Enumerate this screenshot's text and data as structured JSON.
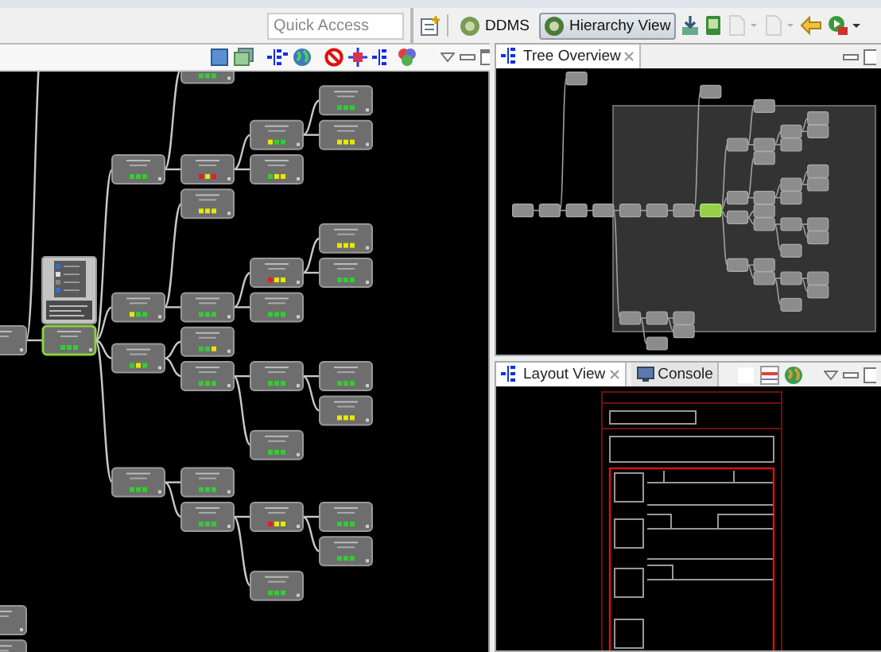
{
  "toolbar": {
    "quick_access": {
      "placeholder": "Quick Access"
    },
    "perspectives": [
      {
        "label": "DDMS",
        "selected": false
      },
      {
        "label": "Hierarchy View",
        "selected": true
      }
    ]
  },
  "tree": {
    "selected": false,
    "children": [
      {
        "selected": false,
        "children": [
          {
            "selected": false
          },
          {
            "selected": false,
            "children": [
              {
                "selected": false,
                "children": [
                  {
                    "selected": false,
                    "children": [
                      {
                        "selected": false,
                        "children": [
                          {
                            "selected": false,
                            "children": [
                              {
                                "selected": false
                              },
                              {
                                "selected": true,
                                "dots": [
                                  {
                                    "color": "#33cc33"
                                  },
                                  {
                                    "color": "#33cc33"
                                  },
                                  {
                                    "color": "#33cc33"
                                  }
                                ],
                                "children": [
                                  {
                                    "selected": false,
                                    "dots": [
                                      {
                                        "color": "#33cc33"
                                      },
                                      {
                                        "color": "#33cc33"
                                      },
                                      {
                                        "color": "#33cc33"
                                      }
                                    ],
                                    "children": [
                                      {
                                        "selected": false,
                                        "dots": [
                                          {
                                            "color": "#33cc33"
                                          },
                                          {
                                            "color": "#33cc33"
                                          },
                                          {
                                            "color": "#33cc33"
                                          }
                                        ]
                                      },
                                      {
                                        "selected": false,
                                        "dots": [
                                          {
                                            "color": "#e02020"
                                          },
                                          {
                                            "color": "#e8e800"
                                          },
                                          {
                                            "color": "#e02020"
                                          }
                                        ],
                                        "children": [
                                          {
                                            "selected": false,
                                            "dots": [
                                              {
                                                "color": "#e8e800"
                                              },
                                              {
                                                "color": "#33cc33"
                                              },
                                              {
                                                "color": "#33cc33"
                                              }
                                            ],
                                            "children": [
                                              {
                                                "selected": false,
                                                "dots": [
                                                  {
                                                    "color": "#33cc33"
                                                  },
                                                  {
                                                    "color": "#33cc33"
                                                  },
                                                  {
                                                    "color": "#33cc33"
                                                  }
                                                ]
                                              },
                                              {
                                                "selected": false,
                                                "dots": [
                                                  {
                                                    "color": "#e8e800"
                                                  },
                                                  {
                                                    "color": "#e8e800"
                                                  },
                                                  {
                                                    "color": "#e8e800"
                                                  }
                                                ]
                                              }
                                            ]
                                          },
                                          {
                                            "selected": false,
                                            "dots": [
                                              {
                                                "color": "#33cc33"
                                              },
                                              {
                                                "color": "#e8e800"
                                              },
                                              {
                                                "color": "#e8e800"
                                              }
                                            ]
                                          }
                                        ]
                                      }
                                    ]
                                  },
                                  {
                                    "selected": false,
                                    "dots": [
                                      {
                                        "color": "#e8e800"
                                      },
                                      {
                                        "color": "#33cc33"
                                      },
                                      {
                                        "color": "#33cc33"
                                      }
                                    ],
                                    "children": [
                                      {
                                        "selected": false,
                                        "dots": [
                                          {
                                            "color": "#e8e800"
                                          },
                                          {
                                            "color": "#e8e800"
                                          },
                                          {
                                            "color": "#e8e800"
                                          }
                                        ]
                                      },
                                      {
                                        "selected": false,
                                        "dots": [
                                          {
                                            "color": "#33cc33"
                                          },
                                          {
                                            "color": "#33cc33"
                                          },
                                          {
                                            "color": "#33cc33"
                                          }
                                        ],
                                        "children": [
                                          {
                                            "selected": false,
                                            "dots": [
                                              {
                                                "color": "#e02020"
                                              },
                                              {
                                                "color": "#e8e800"
                                              },
                                              {
                                                "color": "#e8e800"
                                              }
                                            ],
                                            "children": [
                                              {
                                                "selected": false,
                                                "dots": [
                                                  {
                                                    "color": "#e8e800"
                                                  },
                                                  {
                                                    "color": "#e8e800"
                                                  },
                                                  {
                                                    "color": "#e8e800"
                                                  }
                                                ]
                                              },
                                              {
                                                "selected": false,
                                                "dots": [
                                                  {
                                                    "color": "#33cc33"
                                                  },
                                                  {
                                                    "color": "#33cc33"
                                                  },
                                                  {
                                                    "color": "#33cc33"
                                                  }
                                                ]
                                              }
                                            ]
                                          },
                                          {
                                            "selected": false,
                                            "dots": [
                                              {
                                                "color": "#33cc33"
                                              },
                                              {
                                                "color": "#33cc33"
                                              },
                                              {
                                                "color": "#33cc33"
                                              }
                                            ]
                                          }
                                        ]
                                      }
                                    ]
                                  },
                                  {
                                    "selected": false,
                                    "dots": [
                                      {
                                        "color": "#33cc33"
                                      },
                                      {
                                        "color": "#e8e800"
                                      },
                                      {
                                        "color": "#33cc33"
                                      }
                                    ],
                                    "children": [
                                      {
                                        "selected": false,
                                        "dots": [
                                          {
                                            "color": "#33cc33"
                                          },
                                          {
                                            "color": "#33cc33"
                                          },
                                          {
                                            "color": "#e8e800"
                                          }
                                        ]
                                      },
                                      {
                                        "selected": false,
                                        "dots": [
                                          {
                                            "color": "#33cc33"
                                          },
                                          {
                                            "color": "#33cc33"
                                          },
                                          {
                                            "color": "#33cc33"
                                          }
                                        ],
                                        "children": [
                                          {
                                            "selected": false,
                                            "dots": [
                                              {
                                                "color": "#33cc33"
                                              },
                                              {
                                                "color": "#33cc33"
                                              },
                                              {
                                                "color": "#33cc33"
                                              }
                                            ],
                                            "children": [
                                              {
                                                "selected": false,
                                                "dots": [
                                                  {
                                                    "color": "#33cc33"
                                                  },
                                                  {
                                                    "color": "#33cc33"
                                                  },
                                                  {
                                                    "color": "#33cc33"
                                                  }
                                                ]
                                              },
                                              {
                                                "selected": false,
                                                "dots": [
                                                  {
                                                    "color": "#e8e800"
                                                  },
                                                  {
                                                    "color": "#e8e800"
                                                  },
                                                  {
                                                    "color": "#e8e800"
                                                  }
                                                ]
                                              }
                                            ]
                                          },
                                          {
                                            "selected": false,
                                            "dots": [
                                              {
                                                "color": "#33cc33"
                                              },
                                              {
                                                "color": "#33cc33"
                                              },
                                              {
                                                "color": "#33cc33"
                                              }
                                            ]
                                          }
                                        ]
                                      }
                                    ]
                                  },
                                  {
                                    "selected": false,
                                    "dots": [
                                      {
                                        "color": "#33cc33"
                                      },
                                      {
                                        "color": "#33cc33"
                                      },
                                      {
                                        "color": "#33cc33"
                                      }
                                    ],
                                    "children": [
                                      {
                                        "selected": false,
                                        "dots": [
                                          {
                                            "color": "#33cc33"
                                          },
                                          {
                                            "color": "#33cc33"
                                          },
                                          {
                                            "color": "#33cc33"
                                          }
                                        ]
                                      },
                                      {
                                        "selected": false,
                                        "dots": [
                                          {
                                            "color": "#33cc33"
                                          },
                                          {
                                            "color": "#33cc33"
                                          },
                                          {
                                            "color": "#33cc33"
                                          }
                                        ],
                                        "children": [
                                          {
                                            "selected": false,
                                            "dots": [
                                              {
                                                "color": "#e02020"
                                              },
                                              {
                                                "color": "#e8e800"
                                              },
                                              {
                                                "color": "#e8e800"
                                              }
                                            ],
                                            "children": [
                                              {
                                                "selected": false,
                                                "dots": [
                                                  {
                                                    "color": "#33cc33"
                                                  },
                                                  {
                                                    "color": "#33cc33"
                                                  },
                                                  {
                                                    "color": "#33cc33"
                                                  }
                                                ]
                                              },
                                              {
                                                "selected": false,
                                                "dots": [
                                                  {
                                                    "color": "#33cc33"
                                                  },
                                                  {
                                                    "color": "#33cc33"
                                                  },
                                                  {
                                                    "color": "#33cc33"
                                                  }
                                                ]
                                              }
                                            ]
                                          },
                                          {
                                            "selected": false,
                                            "dots": [
                                              {
                                                "color": "#33cc33"
                                              },
                                              {
                                                "color": "#33cc33"
                                              },
                                              {
                                                "color": "#33cc33"
                                              }
                                            ]
                                          }
                                        ]
                                      }
                                    ]
                                  }
                                ]
                              }
                            ]
                          }
                        ]
                      }
                    ]
                  },
                  {
                    "selected": false,
                    "children": [
                      {
                        "selected": false,
                        "children": [
                          {
                            "selected": false
                          },
                          {
                            "selected": false
                          }
                        ]
                      },
                      {
                        "selected": false
                      }
                    ]
                  }
                ]
              }
            ]
          }
        ]
      }
    ]
  },
  "overview_panel": {
    "tabs": [
      {
        "label": "Tree Overview",
        "selected": true
      }
    ]
  },
  "layout_panel": {
    "tabs": [
      {
        "label": "Layout View",
        "selected": true
      },
      {
        "label": "Console",
        "selected": false
      }
    ]
  }
}
